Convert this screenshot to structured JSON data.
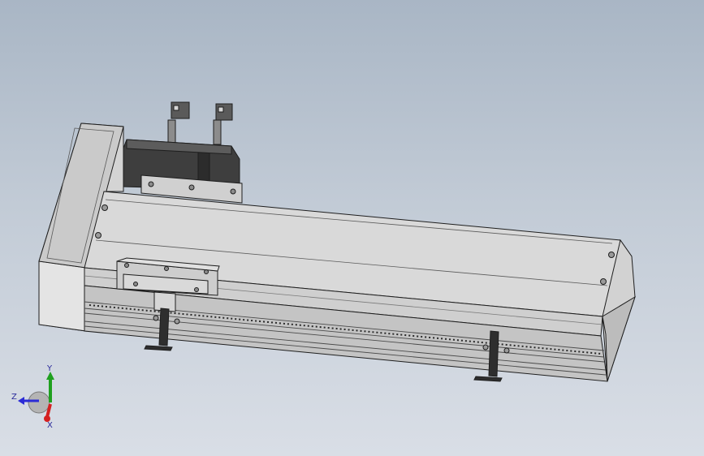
{
  "viewport": {
    "background_top": "#a9b6c5",
    "background_bottom": "#d9dee6",
    "model": {
      "body_color": "#d6d6d6",
      "edge_color": "#1e1e1e",
      "motor_color": "#3a3a3a"
    }
  },
  "triad": {
    "x_label": "X",
    "y_label": "Y",
    "z_label": "Z",
    "x_color": "#d42020",
    "y_color": "#1fa01f",
    "z_color": "#2b2bd6"
  }
}
